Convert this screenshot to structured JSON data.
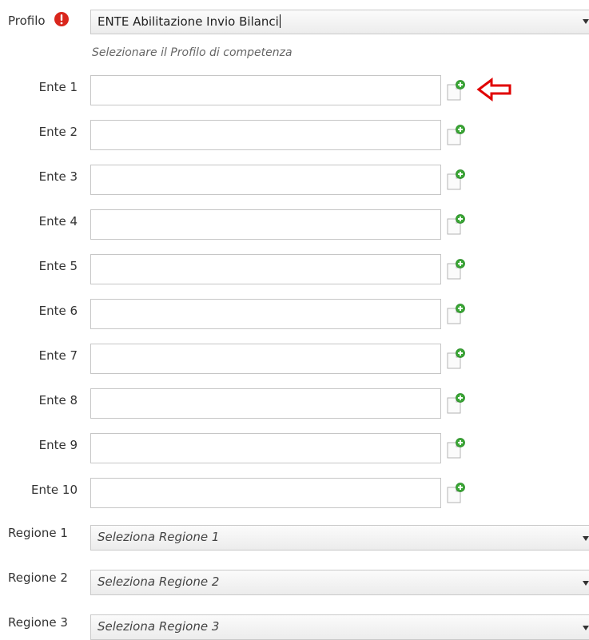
{
  "profilo": {
    "label": "Profilo",
    "selected": "ENTE Abilitazione Invio Bilanci",
    "hint": "Selezionare il Profilo di competenza",
    "warning_icon": "exclamation-circle-icon"
  },
  "enti": [
    {
      "label": "Ente 1",
      "value": ""
    },
    {
      "label": "Ente 2",
      "value": ""
    },
    {
      "label": "Ente 3",
      "value": ""
    },
    {
      "label": "Ente 4",
      "value": ""
    },
    {
      "label": "Ente 5",
      "value": ""
    },
    {
      "label": "Ente 6",
      "value": ""
    },
    {
      "label": "Ente 7",
      "value": ""
    },
    {
      "label": "Ente 8",
      "value": ""
    },
    {
      "label": "Ente 9",
      "value": ""
    },
    {
      "label": "Ente 10",
      "value": ""
    }
  ],
  "regioni": [
    {
      "label": "Regione 1",
      "selected": "Seleziona Regione 1"
    },
    {
      "label": "Regione 2",
      "selected": "Seleziona Regione 2"
    },
    {
      "label": "Regione 3",
      "selected": "Seleziona Regione 3"
    }
  ],
  "icons": {
    "add": "add-document-icon",
    "annotation": "left-arrow-icon"
  },
  "colors": {
    "warning": "#d9261c",
    "add_plus": "#3aa635",
    "annotation": "#e00000"
  }
}
